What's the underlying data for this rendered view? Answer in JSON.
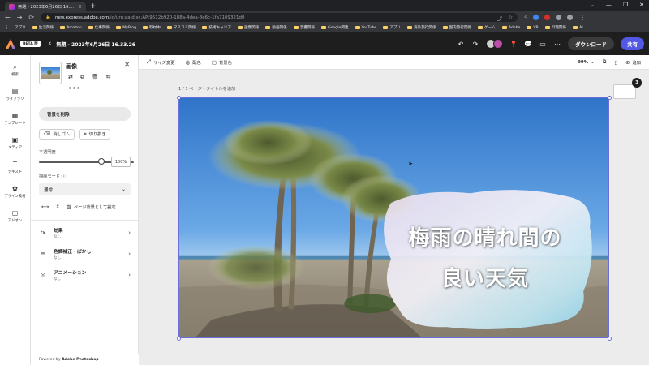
{
  "browser": {
    "tab_title": "無題 - 2023年6月26日 16.33.26",
    "tab_close": "×",
    "new_tab": "+",
    "window_controls": [
      "⌄",
      "—",
      "❐",
      "✕"
    ],
    "nav": [
      "←",
      "→",
      "⟳"
    ],
    "url_host": "new.express.adobe.com",
    "url_path": "/id/urn:aaid:sc:AP:9512b920-188a-4dea-8e6c-1fa7109321d0",
    "omnibox_icons": [
      "⤴",
      "☆"
    ],
    "extensions": [
      {
        "label": "S",
        "color": "#9aa0a6"
      },
      {
        "label": "",
        "color": "#4285f4"
      },
      {
        "label": "",
        "color": "#d93025"
      },
      {
        "label": "",
        "color": "#9aa0a6"
      },
      {
        "label": "",
        "color": "#9aa0a6"
      }
    ],
    "menu": "⋮",
    "bookmarks": [
      {
        "label": "アプリ",
        "type": "apps"
      },
      {
        "label": "生活関係",
        "type": "folder"
      },
      {
        "label": "Amazon",
        "type": "folder"
      },
      {
        "label": "仕事関係",
        "type": "folder"
      },
      {
        "label": "MyBlog",
        "type": "folder"
      },
      {
        "label": "取材中",
        "type": "folder"
      },
      {
        "label": "マスコミ関係",
        "type": "folder"
      },
      {
        "label": "技術キャリア",
        "type": "folder"
      },
      {
        "label": "画像関係",
        "type": "folder"
      },
      {
        "label": "動画関係",
        "type": "folder"
      },
      {
        "label": "音響関係",
        "type": "folder"
      },
      {
        "label": "Google関連",
        "type": "folder"
      },
      {
        "label": "YouTube",
        "type": "folder"
      },
      {
        "label": "アプリ",
        "type": "folder"
      },
      {
        "label": "海外旅行関係",
        "type": "folder"
      },
      {
        "label": "国内旅行関係",
        "type": "folder"
      },
      {
        "label": "ゲーム",
        "type": "folder"
      },
      {
        "label": "Adobe",
        "type": "folder"
      },
      {
        "label": "VR",
        "type": "folder"
      },
      {
        "label": "料理関係",
        "type": "folder"
      },
      {
        "label": "AI",
        "type": "folder"
      }
    ]
  },
  "app": {
    "beta_label": "BETA 版",
    "back_icon": "‹",
    "doc_title": "無題 - 2023年6月26日 16.33.26",
    "undo": "↶",
    "redo": "↷",
    "icons": [
      "📍",
      "💬",
      "▭",
      "⋯"
    ],
    "download_label": "ダウンロード",
    "share_label": "共有",
    "brand_color": "#5258e4"
  },
  "rail": [
    {
      "icon": "⌕",
      "label": "検索",
      "name": "search"
    },
    {
      "icon": "▤",
      "label": "ライブラリ",
      "name": "library"
    },
    {
      "icon": "▦",
      "label": "テンプレート",
      "name": "templates"
    },
    {
      "icon": "▣",
      "label": "メディア",
      "name": "media"
    },
    {
      "icon": "T",
      "label": "テキスト",
      "name": "text"
    },
    {
      "icon": "✿",
      "label": "デザイン素材",
      "name": "design-assets"
    },
    {
      "icon": "▢",
      "label": "アドオン",
      "name": "addons"
    }
  ],
  "panel": {
    "title": "画像",
    "close": "✕",
    "thumb_tools": [
      "⇄",
      "⧉",
      "🗑",
      "⇆"
    ],
    "more": "•••",
    "remove_bg": "背景を削除",
    "eraser": "消しゴム",
    "crop": "切り抜き",
    "opacity_label": "不透明度",
    "opacity_value": "100%",
    "opacity": 1.0,
    "blend_label": "描画モード ⓘ",
    "blend_value": "通常",
    "chevron_down": "⌄",
    "flip_h": "⟷",
    "flip_v": "↕",
    "set_bg_label": "ページ背景として設定",
    "properties": [
      {
        "icon": "fx",
        "name": "効果",
        "sub": "なし",
        "key": "effects"
      },
      {
        "icon": "≡",
        "name": "色調補正・ぼかし",
        "sub": "なし",
        "key": "adjustments"
      },
      {
        "icon": "◎",
        "name": "アニメーション",
        "sub": "なし",
        "key": "animation"
      }
    ],
    "chevron_right": "›",
    "powered_prefix": "Powered by ",
    "powered_brand": "Adobe Photoshop"
  },
  "toolbar": {
    "resize": "サイズ変更",
    "colors": "配色",
    "bg_color": "背景色",
    "zoom": "99%",
    "zoom_chevron": "⌄",
    "add": "追加"
  },
  "canvas": {
    "page_label": "1 / 1 ページ - タイトルを追加",
    "headline_line1": "梅雨の晴れ間の",
    "headline_line2": "良い天気",
    "page_count": "3"
  }
}
